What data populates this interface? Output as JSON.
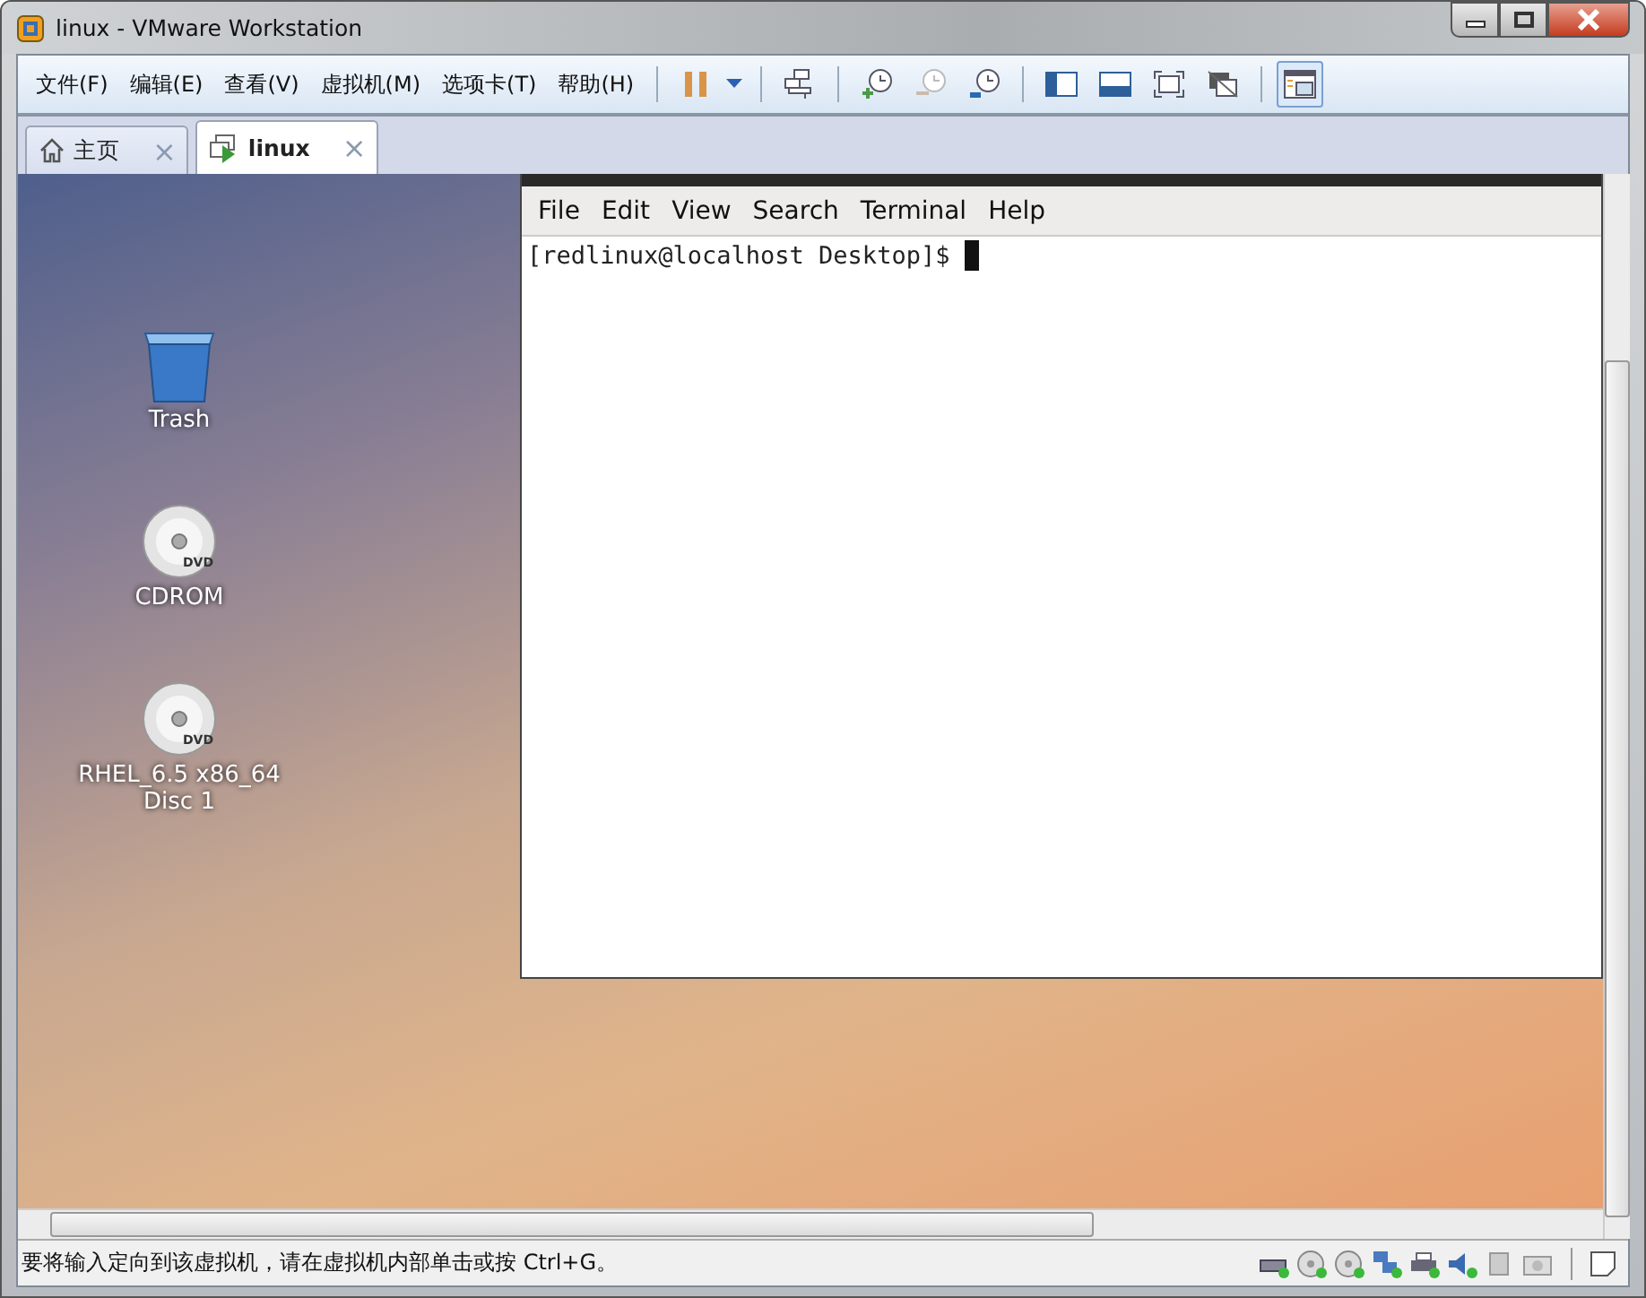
{
  "window": {
    "title": "linux - VMware Workstation"
  },
  "menu": [
    "文件(F)",
    "编辑(E)",
    "查看(V)",
    "虚拟机(M)",
    "选项卡(T)",
    "帮助(H)"
  ],
  "toolbar": [
    {
      "kind": "pause",
      "selected": false
    },
    {
      "kind": "send",
      "selected": false
    },
    {
      "kind": "snap-take",
      "selected": false
    },
    {
      "kind": "snap-revert",
      "selected": false
    },
    {
      "kind": "snap-manage",
      "selected": false
    },
    {
      "kind": "panel-left",
      "selected": false
    },
    {
      "kind": "panel-bottom",
      "selected": false
    },
    {
      "kind": "full",
      "selected": false
    },
    {
      "kind": "nofull",
      "selected": false
    },
    {
      "kind": "console",
      "selected": true
    }
  ],
  "tabs": [
    {
      "kind": "home",
      "label": "主页",
      "close": "×",
      "selected": false
    },
    {
      "kind": "vm",
      "label": "linux",
      "close": "×",
      "selected": true
    }
  ],
  "desktop_icons": [
    {
      "kind": "trash",
      "label": "Trash"
    },
    {
      "kind": "disc",
      "badge": "DVD",
      "label": "CDROM"
    },
    {
      "kind": "disc",
      "badge": "DVD",
      "label": "RHEL_6.5 x86_64 Disc 1"
    }
  ],
  "terminal": {
    "menu": [
      "File",
      "Edit",
      "View",
      "Search",
      "Terminal",
      "Help"
    ],
    "prompt": "[redlinux@localhost Desktop]$"
  },
  "status_bar": {
    "message": "要将输入定向到该虚拟机，请在虚拟机内部单击或按 Ctrl+G。",
    "devices": [
      {
        "kind": "hdd",
        "connected": true
      },
      {
        "kind": "cd",
        "connected": true
      },
      {
        "kind": "cd",
        "connected": true
      },
      {
        "kind": "network",
        "connected": true
      },
      {
        "kind": "printer",
        "connected": true
      },
      {
        "kind": "sound",
        "connected": true
      },
      {
        "kind": "usb",
        "connected": false
      },
      {
        "kind": "camera",
        "connected": false
      }
    ]
  }
}
